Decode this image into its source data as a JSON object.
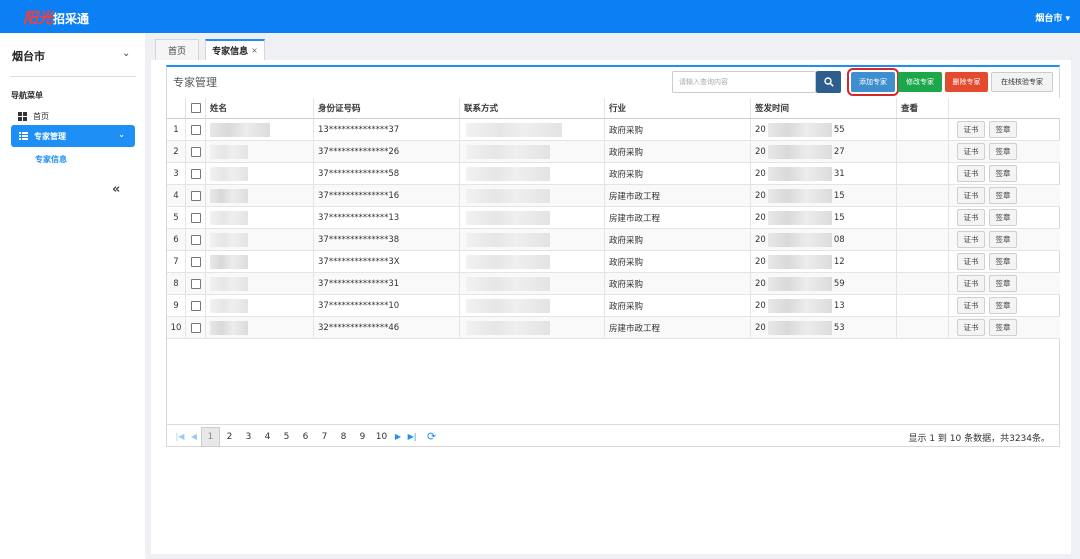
{
  "header": {
    "logo_main": "阳光",
    "logo_sub": "招采通",
    "user": "烟台市 ▾"
  },
  "sidebar": {
    "city": "烟台市",
    "nav_header": "导航菜单",
    "items": [
      {
        "label": "首页",
        "icon": "grid-icon"
      },
      {
        "label": "专家管理",
        "icon": "list-icon",
        "active": true
      }
    ],
    "sub_item": "专家信息",
    "collapse": "«"
  },
  "tabs": [
    {
      "label": "首页"
    },
    {
      "label": "专家信息",
      "close": "×"
    }
  ],
  "panel": {
    "title": "专家管理",
    "search_placeholder": "请输入查询内容",
    "buttons": {
      "add": "添加专家",
      "edit": "修改专家",
      "delete": "删除专家",
      "online": "在线核验专家"
    }
  },
  "table": {
    "columns": [
      "姓名",
      "身份证号码",
      "联系方式",
      "行业",
      "签发时间",
      "查看"
    ],
    "action_labels": [
      "证书",
      "签章"
    ],
    "rows": [
      {
        "idx": "1",
        "id": "13**************37",
        "industry": "政府采购",
        "time_pre": "20",
        "time_suf": "55"
      },
      {
        "idx": "2",
        "id": "37**************26",
        "industry": "政府采购",
        "time_pre": "20",
        "time_suf": "27"
      },
      {
        "idx": "3",
        "id": "37**************58",
        "industry": "政府采购",
        "time_pre": "20",
        "time_suf": "31"
      },
      {
        "idx": "4",
        "id": "37**************16",
        "industry": "房建市政工程",
        "time_pre": "20",
        "time_suf": "15"
      },
      {
        "idx": "5",
        "id": "37**************13",
        "industry": "房建市政工程",
        "time_pre": "20",
        "time_suf": "15"
      },
      {
        "idx": "6",
        "id": "37**************38",
        "industry": "政府采购",
        "time_pre": "20",
        "time_suf": "08"
      },
      {
        "idx": "7",
        "id": "37**************3X",
        "industry": "政府采购",
        "time_pre": "20",
        "time_suf": "12"
      },
      {
        "idx": "8",
        "id": "37**************31",
        "industry": "政府采购",
        "time_pre": "20",
        "time_suf": "59"
      },
      {
        "idx": "9",
        "id": "37**************10",
        "industry": "政府采购",
        "time_pre": "20",
        "time_suf": "13"
      },
      {
        "idx": "10",
        "id": "32**************46",
        "industry": "房建市政工程",
        "time_pre": "20",
        "time_suf": "53"
      }
    ]
  },
  "pager": {
    "pages": [
      "1",
      "2",
      "3",
      "4",
      "5",
      "6",
      "7",
      "8",
      "9",
      "10"
    ],
    "current": "1",
    "info": "显示 1 到 10 条数据，共3234条。"
  }
}
